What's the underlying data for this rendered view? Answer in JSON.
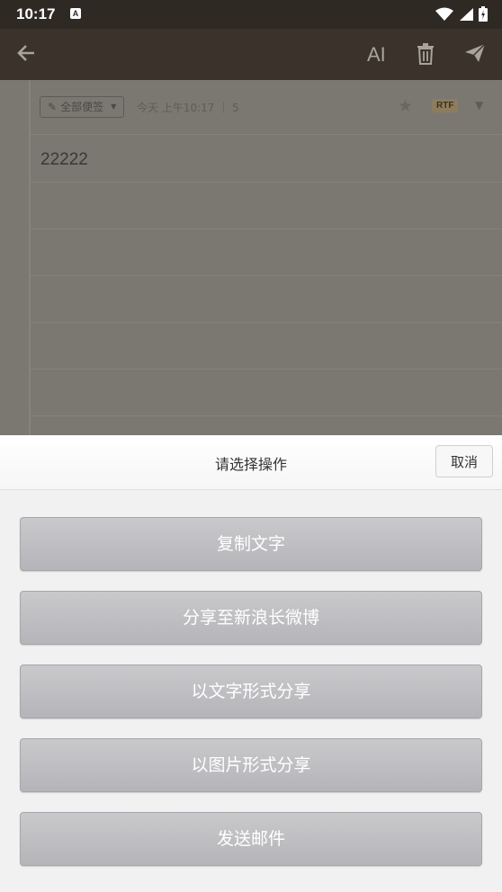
{
  "status_bar": {
    "time": "10:17",
    "notification_icon": "A"
  },
  "app_bar": {
    "back_icon": "arrow-left",
    "ai_label": "AI",
    "trash_icon": "trash",
    "send_icon": "paper-plane"
  },
  "note": {
    "folder_label": "全部便签",
    "meta": "今天 上午10:17 ｜ 5",
    "badge": "RTF",
    "body_text": "22222"
  },
  "sheet": {
    "title": "请选择操作",
    "cancel_label": "取消",
    "actions": [
      {
        "label": "复制文字"
      },
      {
        "label": "分享至新浪长微博"
      },
      {
        "label": "以文字形式分享"
      },
      {
        "label": "以图片形式分享"
      },
      {
        "label": "发送邮件"
      }
    ]
  },
  "colors": {
    "app_bar": "#3a322b",
    "status_bar": "#2f2924",
    "button_gray": "#bdbdc1"
  }
}
